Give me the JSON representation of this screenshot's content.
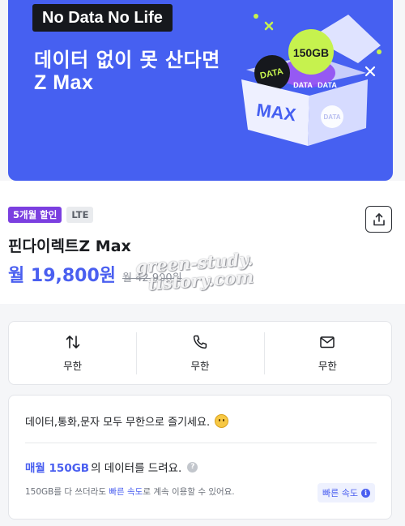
{
  "banner": {
    "badge": "No Data No Life",
    "line1": "데이터 없이 못 산다면",
    "line2": "Z Max",
    "art": {
      "bubble_large": "150GB",
      "bubble_small": "DATA",
      "box_label": "MAX",
      "box_data_1": "DATA",
      "box_data_2": "DATA",
      "box_data_3": "DATA",
      "box_color": "#eef0ff",
      "accent_green": "#c6f24e",
      "accent_purple": "#8f4df2"
    },
    "color": "#4660f1"
  },
  "product": {
    "tags": {
      "discount": "5개월 할인",
      "network": "LTE"
    },
    "share_icon": "share-icon",
    "name": "핀다이렉트Z Max",
    "price_now": "월 19,800원",
    "price_old": "월 42,900원",
    "watermark_line1": "green-study.",
    "watermark_line2": "tistory.com"
  },
  "features": [
    {
      "icon": "data-transfer-icon",
      "label": "무한"
    },
    {
      "icon": "phone-icon",
      "label": "무한"
    },
    {
      "icon": "mail-icon",
      "label": "무한"
    }
  ],
  "info": {
    "title": "데이터,통화,문자 모두 무한으로 즐기세요.",
    "data_prefix": "매월 150GB",
    "data_suffix": "의 데이터를 드려요.",
    "help": "?",
    "desc_before": "150GB를 다 쓰더라도 ",
    "desc_link": "빠른 속도",
    "desc_after": "로 계속 이용할 수 있어요.",
    "speed_chip": "빠른 속도",
    "speed_chip_icon": "i"
  },
  "colors": {
    "accent": "#4a5ff0",
    "discount_tag": "#7b3fe0"
  }
}
